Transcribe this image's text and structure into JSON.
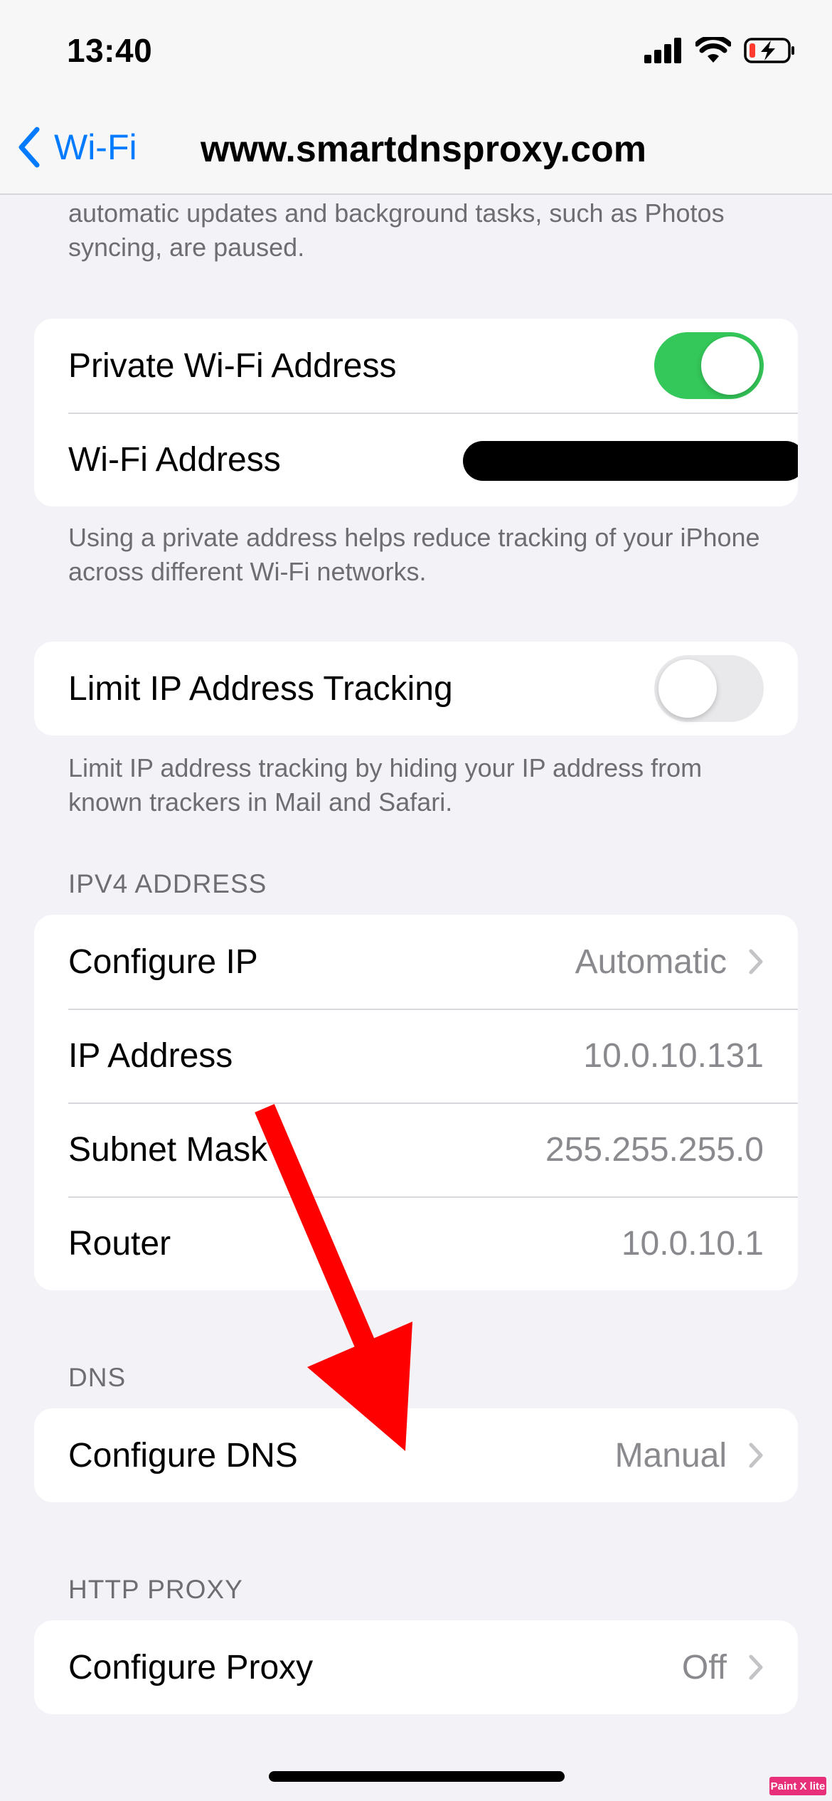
{
  "status_bar": {
    "time": "13:40"
  },
  "nav": {
    "back_label": "Wi-Fi",
    "title": "www.smartdnsproxy.com"
  },
  "top_footnote": "automatic updates and background tasks, such as Photos syncing, are paused.",
  "private_wifi": {
    "toggle_label": "Private Wi-Fi Address",
    "toggle_on": true,
    "address_label": "Wi-Fi Address",
    "footnote": "Using a private address helps reduce tracking of your iPhone across different Wi-Fi networks."
  },
  "limit_ip": {
    "label": "Limit IP Address Tracking",
    "toggle_on": false,
    "footnote": "Limit IP address tracking by hiding your IP address from known trackers in Mail and Safari."
  },
  "ipv4": {
    "header": "IPV4 ADDRESS",
    "rows": [
      {
        "label": "Configure IP",
        "value": "Automatic"
      },
      {
        "label": "IP Address",
        "value": "10.0.10.131"
      },
      {
        "label": "Subnet Mask",
        "value": "255.255.255.0"
      },
      {
        "label": "Router",
        "value": "10.0.10.1"
      }
    ]
  },
  "dns": {
    "header": "DNS",
    "label": "Configure DNS",
    "value": "Manual"
  },
  "http_proxy": {
    "header": "HTTP PROXY",
    "label": "Configure Proxy",
    "value": "Off"
  },
  "watermark": "Paint X lite",
  "colors": {
    "accent": "#007aff",
    "toggle_on": "#34c759",
    "annotation_arrow": "#ff0000"
  }
}
